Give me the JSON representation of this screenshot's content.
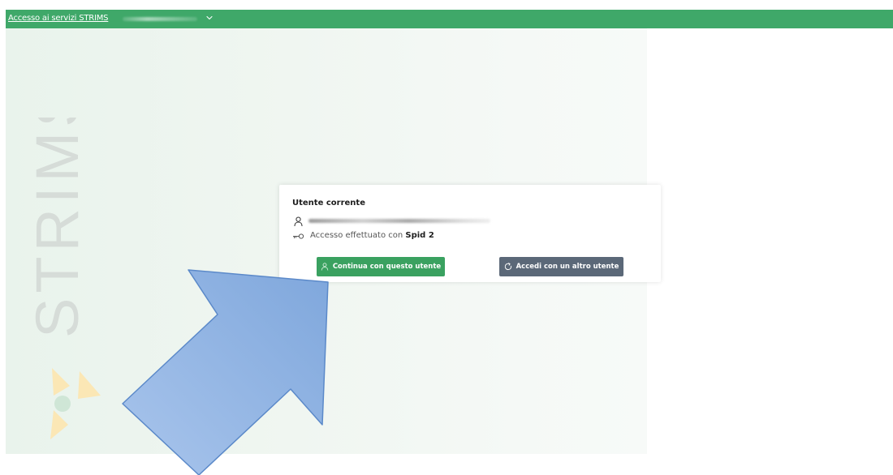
{
  "header": {
    "link_label": "Accesso ai servizi STRIMS",
    "bar_color": "#3fa869"
  },
  "background": {
    "watermark_text": "STRIMS"
  },
  "card": {
    "title": "Utente corrente",
    "access_prefix": "Accesso effettuato con ",
    "access_method": "Spid 2",
    "continue_button": "Continua con questo utente",
    "other_user_button": "Accedi con un altro utente",
    "icons": {
      "user": "user-icon",
      "key": "key-icon",
      "refresh": "refresh-icon"
    },
    "colors": {
      "continue": "#3aa160",
      "other": "#5b6878"
    }
  },
  "annotation": {
    "arrow_color": "#8fb3e2"
  }
}
